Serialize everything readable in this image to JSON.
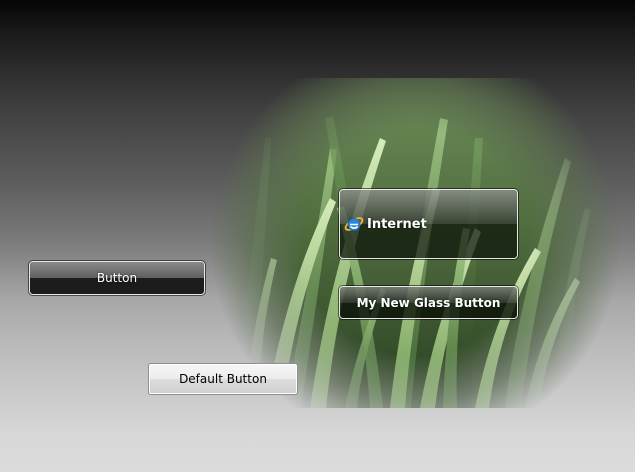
{
  "buttons": {
    "plain": {
      "label": "Button"
    },
    "internet": {
      "label": "Internet",
      "icon": "internet-explorer-icon"
    },
    "glass": {
      "label": "My New Glass Button"
    },
    "default": {
      "label": "Default Button"
    }
  },
  "background": {
    "image": "grass-image"
  },
  "colors": {
    "grass_light": "#9fc98a",
    "grass_dark": "#2e4a23",
    "glass_border": "#e8e8e8",
    "ie_blue": "#2a86d8",
    "ie_orange": "#f2b53a"
  }
}
